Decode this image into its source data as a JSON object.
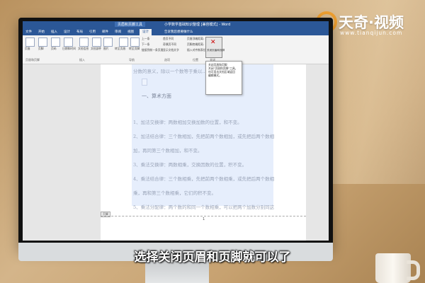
{
  "word": {
    "title": "小学数学基础知识整理 [兼容模式] - Word",
    "context_tab": "页眉和页脚工具",
    "tabs": [
      "文件",
      "开始",
      "插入",
      "设计",
      "布局",
      "引用",
      "邮件",
      "审阅",
      "视图",
      "设计"
    ],
    "tell_me": "告诉我您想要做什么",
    "ribbon": {
      "buttons": [
        "页眉",
        "页脚",
        "页码",
        "日期和时间",
        "文档信息",
        "文档部件",
        "图片",
        "联机图片",
        "转至页眉",
        "转至页脚"
      ],
      "nav_items": [
        "上一条",
        "下一条",
        "链接到前一条页眉"
      ],
      "options": [
        "首页不同",
        "奇偶页不同",
        "显示文档文字"
      ],
      "position": [
        "页眉顶端距离:",
        "页脚底端距离:",
        "插入对齐制表位"
      ],
      "position_values": [
        "1.5 厘米",
        "1.75 厘米"
      ],
      "groups": [
        "页眉和页脚",
        "插入",
        "导航",
        "选项",
        "位置",
        "关闭"
      ],
      "close_label": "关闭页眉和页脚"
    },
    "tooltip": [
      "关闭页眉和页脚",
      "关闭\"页眉和页脚\"工具。",
      "也可双击文档区域返回",
      "编辑模式。"
    ],
    "document": {
      "lines": [
        "分数的意义，除以一个数等于乘以...",
        "一、算术方面",
        "1、加法交换律：两数相加交换加数的位置，和不变。",
        "2、加法结合律：三个数相加，先把前两个数相加，或先把后两个数相",
        "加，再同第三个数相加，和不变。",
        "3、乘法交换律：两数相乘，交换因数的位置，积不变。",
        "4、乘法结合律：三个数相乘，先把前两个数相乘，或先把后两个数相",
        "乘，再和第三个数相乘，它们的积不变。",
        "5、乘法分配律：两个数的和同一个数相乘，可以把两个加数分别同这"
      ],
      "footer_tag": "页脚",
      "page_number": "1"
    }
  },
  "subtitle": "选择关闭页眉和页脚就可以了",
  "logo": {
    "text": "天奇·视频",
    "url": "www.tianqijun.com"
  },
  "colors": {
    "word_blue": "#2b5797",
    "logo_orange": "#f0a030"
  }
}
